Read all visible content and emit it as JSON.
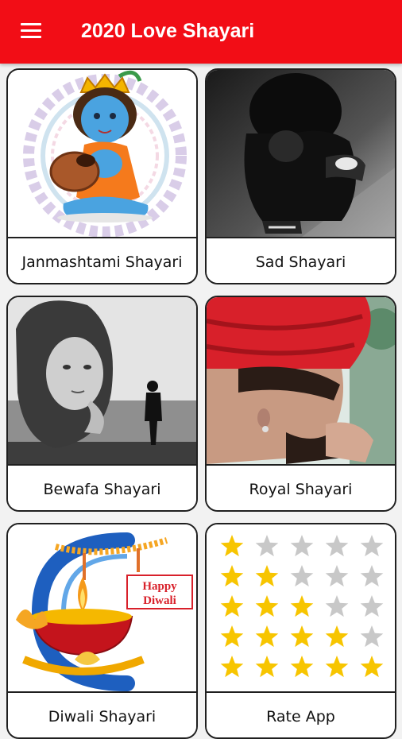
{
  "app": {
    "title": "2020 Love Shayari"
  },
  "categories": [
    {
      "label": "Janmashtami Shayari"
    },
    {
      "label": "Sad Shayari"
    },
    {
      "label": "Bewafa Shayari"
    },
    {
      "label": "Royal Shayari"
    },
    {
      "label": "Diwali Shayari"
    },
    {
      "label": "Rate App"
    }
  ],
  "diwali_banner": {
    "line1": "Happy",
    "line2": "Diwali"
  },
  "rating_chart": {
    "rows": [
      1,
      2,
      3,
      4,
      5
    ],
    "max_stars": 5,
    "filled_color": "#f7c500",
    "empty_color": "#c8c8c8"
  },
  "colors": {
    "appbar": "#f20d16",
    "card_border": "#1f1f1f"
  }
}
